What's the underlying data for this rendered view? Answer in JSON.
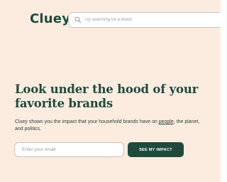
{
  "brand": {
    "logo_text": "Cluey",
    "accent_color": "#1f4a3c",
    "background_color": "#fcece0"
  },
  "search": {
    "icon": "search-icon",
    "placeholder": "Try searching for a brand"
  },
  "hero": {
    "headline": "Look under the hood of your favorite brands",
    "subtext_prefix": "Cluey shows you the impact that your household brands have on ",
    "link_people": "people",
    "subtext_sep_1": ", ",
    "link_planet": "the planet",
    "subtext_sep_2": ", and ",
    "link_politics": "politics",
    "subtext_suffix": "."
  },
  "signup": {
    "email_placeholder": "Enter your email",
    "cta_label": "SEE MY IMPACT"
  }
}
